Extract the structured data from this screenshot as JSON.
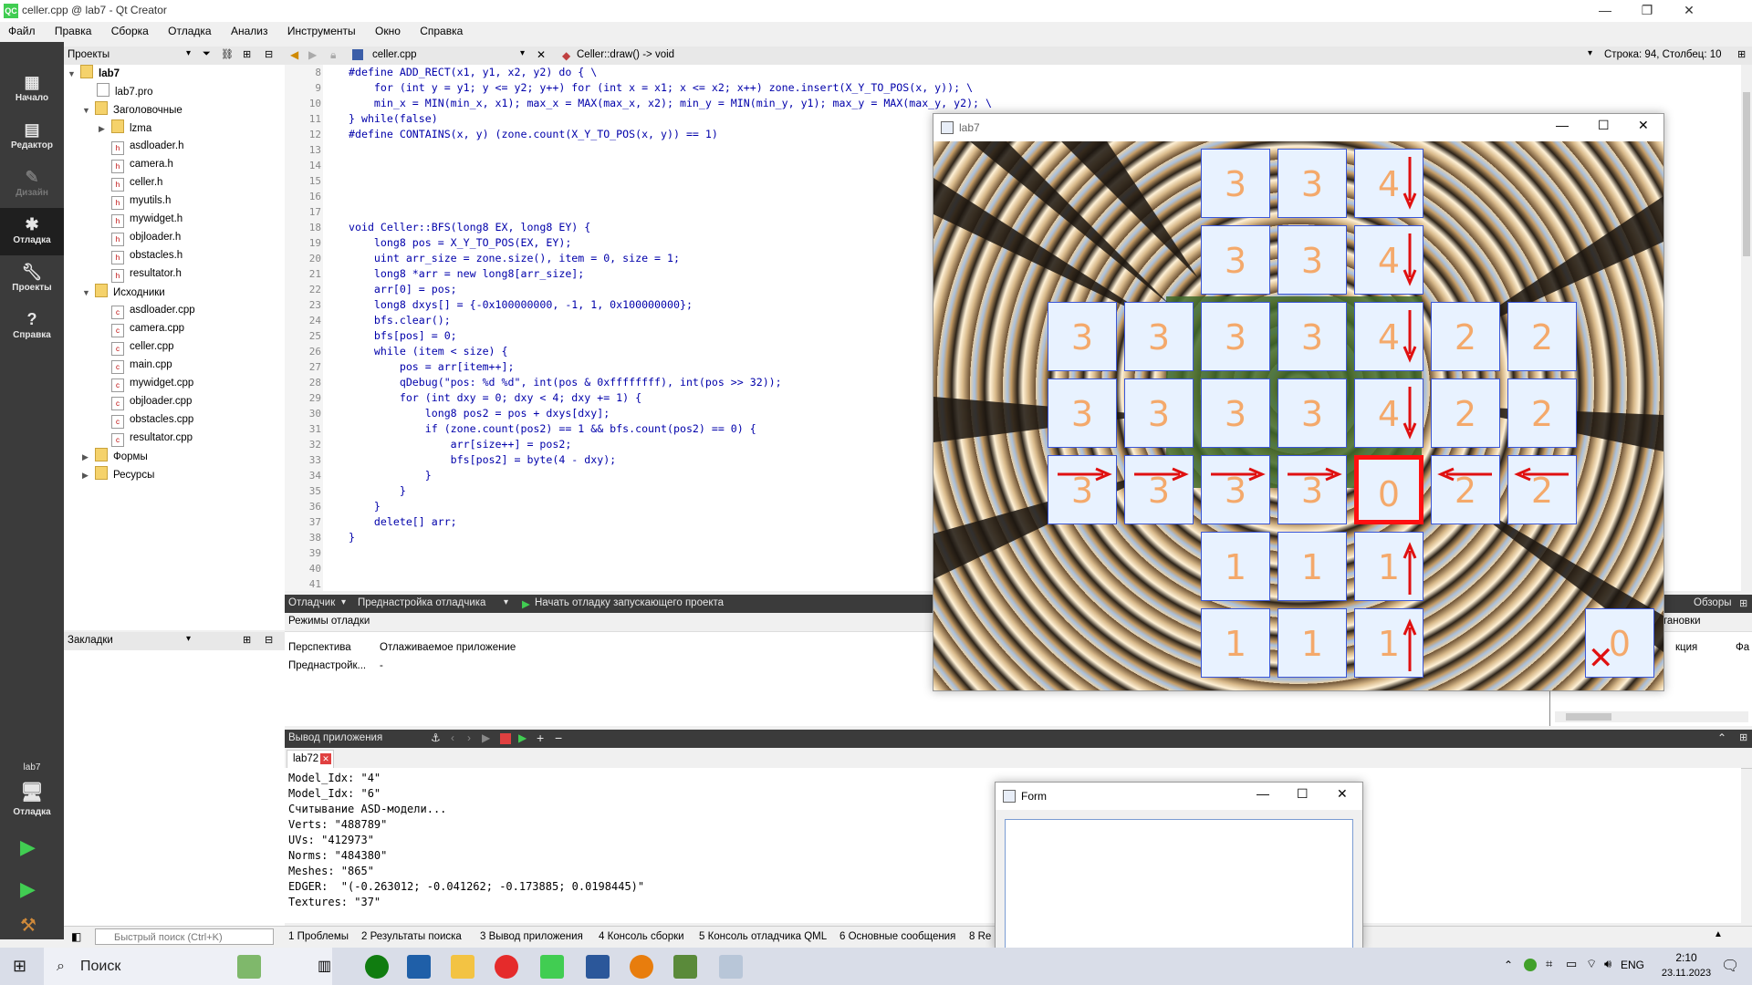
{
  "window": {
    "title": "celler.cpp @ lab7 - Qt Creator",
    "app_icon": "QC"
  },
  "menu": [
    "Файл",
    "Правка",
    "Сборка",
    "Отладка",
    "Анализ",
    "Инструменты",
    "Окно",
    "Справка"
  ],
  "modes": [
    {
      "label": "Начало",
      "icon": "grid-icon"
    },
    {
      "label": "Редактор",
      "icon": "document-icon"
    },
    {
      "label": "Дизайн",
      "icon": "pen-icon"
    },
    {
      "label": "Отладка",
      "icon": "bug-icon"
    },
    {
      "label": "Проекты",
      "icon": "wrench-icon"
    },
    {
      "label": "Справка",
      "icon": "help-icon"
    }
  ],
  "kit": {
    "project": "lab7",
    "mode": "Отладка"
  },
  "projects": {
    "header": "Проекты",
    "tree": [
      {
        "label": "lab7",
        "type": "project"
      },
      {
        "label": "lab7.pro",
        "type": "pro"
      },
      {
        "label": "Заголовочные",
        "type": "folder"
      },
      {
        "label": "lzma",
        "type": "folder"
      },
      {
        "label": "asdloader.h",
        "type": "h"
      },
      {
        "label": "camera.h",
        "type": "h"
      },
      {
        "label": "celler.h",
        "type": "h"
      },
      {
        "label": "myutils.h",
        "type": "h"
      },
      {
        "label": "mywidget.h",
        "type": "h"
      },
      {
        "label": "objloader.h",
        "type": "h"
      },
      {
        "label": "obstacles.h",
        "type": "h"
      },
      {
        "label": "resultator.h",
        "type": "h"
      },
      {
        "label": "Исходники",
        "type": "folder"
      },
      {
        "label": "asdloader.cpp",
        "type": "cpp"
      },
      {
        "label": "camera.cpp",
        "type": "cpp"
      },
      {
        "label": "celler.cpp",
        "type": "cpp"
      },
      {
        "label": "main.cpp",
        "type": "cpp"
      },
      {
        "label": "mywidget.cpp",
        "type": "cpp"
      },
      {
        "label": "objloader.cpp",
        "type": "cpp"
      },
      {
        "label": "obstacles.cpp",
        "type": "cpp"
      },
      {
        "label": "resultator.cpp",
        "type": "cpp"
      },
      {
        "label": "Формы",
        "type": "folder"
      },
      {
        "label": "Ресурсы",
        "type": "folder"
      }
    ]
  },
  "bookmarks": {
    "header": "Закладки"
  },
  "editor": {
    "file": "celler.cpp",
    "symbol": "Celler::draw() -> void",
    "position": "Строка: 94, Столбец: 10",
    "lines": [
      {
        "n": "8",
        "text": "#define ADD_RECT(x1, y1, x2, y2) do { \\"
      },
      {
        "n": "9",
        "text": "    for (int y = y1; y <= y2; y++) for (int x = x1; x <= x2; x++) zone.insert(X_Y_TO_POS(x, y)); \\"
      },
      {
        "n": "10",
        "text": "    min_x = MIN(min_x, x1); max_x = MAX(max_x, x2); min_y = MIN(min_y, y1); max_y = MAX(max_y, y2); \\"
      },
      {
        "n": "11",
        "text": "} while(false)"
      },
      {
        "n": "12",
        "text": "#define CONTAINS(x, y) (zone.count(X_Y_TO_POS(x, y)) == 1)"
      },
      {
        "n": "13",
        "text": ""
      },
      {
        "n": "14",
        "text": ""
      },
      {
        "n": "15",
        "text": ""
      },
      {
        "n": "16",
        "text": ""
      },
      {
        "n": "17",
        "text": ""
      },
      {
        "n": "18",
        "text": "void Celler::BFS(long8 EX, long8 EY) {"
      },
      {
        "n": "19",
        "text": "    long8 pos = X_Y_TO_POS(EX, EY);"
      },
      {
        "n": "20",
        "text": "    uint arr_size = zone.size(), item = 0, size = 1;"
      },
      {
        "n": "21",
        "text": "    long8 *arr = new long8[arr_size];"
      },
      {
        "n": "22",
        "text": "    arr[0] = pos;"
      },
      {
        "n": "23",
        "text": "    long8 dxys[] = {-0x100000000, -1, 1, 0x100000000};"
      },
      {
        "n": "24",
        "text": "    bfs.clear();"
      },
      {
        "n": "25",
        "text": "    bfs[pos] = 0;"
      },
      {
        "n": "26",
        "text": "    while (item < size) {"
      },
      {
        "n": "27",
        "text": "        pos = arr[item++];"
      },
      {
        "n": "28",
        "text": "        qDebug(\"pos: %d %d\", int(pos & 0xffffffff), int(pos >> 32));"
      },
      {
        "n": "29",
        "text": "        for (int dxy = 0; dxy < 4; dxy += 1) {"
      },
      {
        "n": "30",
        "text": "            long8 pos2 = pos + dxys[dxy];"
      },
      {
        "n": "31",
        "text": "            if (zone.count(pos2) == 1 && bfs.count(pos2) == 0) {"
      },
      {
        "n": "32",
        "text": "                arr[size++] = pos2;"
      },
      {
        "n": "33",
        "text": "                bfs[pos2] = byte(4 - dxy);"
      },
      {
        "n": "34",
        "text": "            }"
      },
      {
        "n": "35",
        "text": "        }"
      },
      {
        "n": "36",
        "text": "    }"
      },
      {
        "n": "37",
        "text": "    delete[] arr;"
      },
      {
        "n": "38",
        "text": "}"
      },
      {
        "n": "39",
        "text": ""
      },
      {
        "n": "40",
        "text": ""
      },
      {
        "n": "41",
        "text": ""
      }
    ]
  },
  "debugger": {
    "bar_label": "Отладчик",
    "preset_label": "Преднастройка отладчика",
    "start_label": "Начать отладку запускающего проекта",
    "overview_label": "Обзоры",
    "modes_header": "Режимы отладки",
    "col1": "Перспектива",
    "col2": "Отлаживаемое приложение",
    "row_label": "Преднастройк...",
    "row_value": "-",
    "right_header": "становки",
    "right_col": "кция",
    "right_col2": "Фа"
  },
  "output": {
    "bar_label": "Вывод приложения",
    "tab": "lab72",
    "lines": [
      "Model_Idx: \"4\"",
      "Model_Idx: \"6\"",
      "Считывание ASD-модели...",
      "Verts: \"488789\"",
      "UVs: \"412973\"",
      "Norms: \"484380\"",
      "Meshes: \"865\"",
      "EDGER:  \"(-0.263012; -0.041262; -0.173885; 0.0198445)\"",
      "Textures: \"37\""
    ]
  },
  "statusbar": {
    "search_placeholder": "Быстрый поиск (Ctrl+K)",
    "tabs": [
      "1 Проблемы",
      "2 Результаты поиска",
      "3 Вывод приложения",
      "4 Консоль сборки",
      "5 Консоль отладчика QML",
      "6 Основные сообщения",
      "8 Re"
    ]
  },
  "lab7_window": {
    "title": "lab7",
    "cells": [
      {
        "r": 0,
        "c": 2,
        "v": "3"
      },
      {
        "r": 0,
        "c": 3,
        "v": "3"
      },
      {
        "r": 0,
        "c": 4,
        "v": "4",
        "arrow": "down"
      },
      {
        "r": 1,
        "c": 2,
        "v": "3"
      },
      {
        "r": 1,
        "c": 3,
        "v": "3"
      },
      {
        "r": 1,
        "c": 4,
        "v": "4",
        "arrow": "down"
      },
      {
        "r": 2,
        "c": 0,
        "v": "3"
      },
      {
        "r": 2,
        "c": 1,
        "v": "3"
      },
      {
        "r": 2,
        "c": 2,
        "v": "3"
      },
      {
        "r": 2,
        "c": 3,
        "v": "3"
      },
      {
        "r": 2,
        "c": 4,
        "v": "4",
        "arrow": "down"
      },
      {
        "r": 2,
        "c": 5,
        "v": "2"
      },
      {
        "r": 2,
        "c": 6,
        "v": "2"
      },
      {
        "r": 3,
        "c": 0,
        "v": "3"
      },
      {
        "r": 3,
        "c": 1,
        "v": "3"
      },
      {
        "r": 3,
        "c": 2,
        "v": "3"
      },
      {
        "r": 3,
        "c": 3,
        "v": "3"
      },
      {
        "r": 3,
        "c": 4,
        "v": "4",
        "arrow": "down"
      },
      {
        "r": 3,
        "c": 5,
        "v": "2"
      },
      {
        "r": 3,
        "c": 6,
        "v": "2"
      },
      {
        "r": 4,
        "c": 0,
        "v": "3",
        "arrow": "right"
      },
      {
        "r": 4,
        "c": 1,
        "v": "3",
        "arrow": "right"
      },
      {
        "r": 4,
        "c": 2,
        "v": "3",
        "arrow": "right"
      },
      {
        "r": 4,
        "c": 3,
        "v": "3",
        "arrow": "right"
      },
      {
        "r": 4,
        "c": 4,
        "v": "0",
        "target": true
      },
      {
        "r": 4,
        "c": 5,
        "v": "2",
        "arrow": "left"
      },
      {
        "r": 4,
        "c": 6,
        "v": "2",
        "arrow": "left"
      },
      {
        "r": 5,
        "c": 2,
        "v": "1"
      },
      {
        "r": 5,
        "c": 3,
        "v": "1"
      },
      {
        "r": 5,
        "c": 4,
        "v": "1",
        "arrow": "up"
      },
      {
        "r": 6,
        "c": 2,
        "v": "1"
      },
      {
        "r": 6,
        "c": 3,
        "v": "1"
      },
      {
        "r": 6,
        "c": 4,
        "v": "1",
        "arrow": "up"
      },
      {
        "r": 6,
        "c": 7,
        "v": "0",
        "cross": true
      }
    ]
  },
  "form_window": {
    "title": "Form"
  },
  "taskbar": {
    "search": "Поиск",
    "lang": "ENG",
    "time": "2:10",
    "date": "23.11.2023"
  },
  "colors": {
    "accent": "#3a56d8",
    "cell_text": "#f4a96b",
    "target_border": "#ff1010",
    "arrow": "#e01010"
  }
}
